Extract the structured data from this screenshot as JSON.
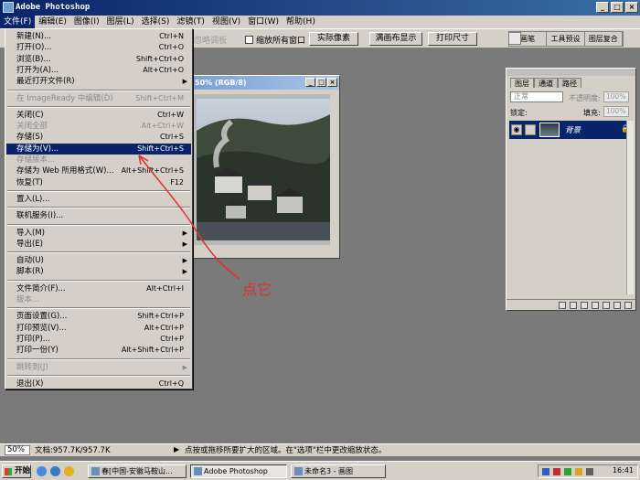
{
  "app": {
    "title": "Adobe Photoshop",
    "window_buttons": [
      "_",
      "□",
      "×"
    ]
  },
  "menubar": [
    {
      "label": "文件(F)",
      "active": true
    },
    {
      "label": "编辑(E)"
    },
    {
      "label": "图像(I)"
    },
    {
      "label": "图层(L)"
    },
    {
      "label": "选择(S)"
    },
    {
      "label": "滤镜(T)"
    },
    {
      "label": "视图(V)"
    },
    {
      "label": "窗口(W)"
    },
    {
      "label": "帮助(H)"
    }
  ],
  "options": {
    "faded_text": "忽略调板",
    "checkbox_label": "缩放所有窗口",
    "buttons": [
      "实际像素",
      "满画布显示",
      "打印尺寸"
    ],
    "palette_well": [
      "画笔",
      "工具预设",
      "图层复合"
    ]
  },
  "file_menu": [
    {
      "label": "新建(N)...",
      "shortcut": "Ctrl+N"
    },
    {
      "label": "打开(O)...",
      "shortcut": "Ctrl+O"
    },
    {
      "label": "浏览(B)...",
      "shortcut": "Shift+Ctrl+O"
    },
    {
      "label": "打开为(A)...",
      "shortcut": "Alt+Ctrl+O"
    },
    {
      "label": "最近打开文件(R)",
      "submenu": true
    },
    {
      "sep": true
    },
    {
      "label": "在 ImageReady 中编辑(D)",
      "shortcut": "Shift+Ctrl+M",
      "disabled": true
    },
    {
      "sep": true
    },
    {
      "label": "关闭(C)",
      "shortcut": "Ctrl+W"
    },
    {
      "label": "关闭全部",
      "shortcut": "Alt+Ctrl+W",
      "disabled": true
    },
    {
      "label": "存储(S)",
      "shortcut": "Ctrl+S"
    },
    {
      "label": "存储为(V)...",
      "shortcut": "Shift+Ctrl+S",
      "highlighted": true
    },
    {
      "label": "存储版本...",
      "disabled": true
    },
    {
      "label": "存储为 Web 所用格式(W)...",
      "shortcut": "Alt+Shift+Ctrl+S"
    },
    {
      "label": "恢复(T)",
      "shortcut": "F12"
    },
    {
      "sep": true
    },
    {
      "label": "置入(L)..."
    },
    {
      "sep": true
    },
    {
      "label": "联机服务(I)..."
    },
    {
      "sep": true
    },
    {
      "label": "导入(M)",
      "submenu": true
    },
    {
      "label": "导出(E)",
      "submenu": true
    },
    {
      "sep": true
    },
    {
      "label": "自动(U)",
      "submenu": true
    },
    {
      "label": "脚本(R)",
      "submenu": true
    },
    {
      "sep": true
    },
    {
      "label": "文件简介(F)...",
      "shortcut": "Alt+Ctrl+I"
    },
    {
      "label": "版本...",
      "disabled": true
    },
    {
      "sep": true
    },
    {
      "label": "页面设置(G)...",
      "shortcut": "Shift+Ctrl+P"
    },
    {
      "label": "打印预览(V)...",
      "shortcut": "Alt+Ctrl+P"
    },
    {
      "label": "打印(P)...",
      "shortcut": "Ctrl+P"
    },
    {
      "label": "打印一份(Y)",
      "shortcut": "Alt+Shift+Ctrl+P"
    },
    {
      "sep": true
    },
    {
      "label": "跳转到(J)",
      "submenu": true,
      "disabled": true
    },
    {
      "sep": true
    },
    {
      "label": "退出(X)",
      "shortcut": "Ctrl+Q"
    }
  ],
  "document": {
    "title": "50% (RGB/8)"
  },
  "layers_panel": {
    "tabs": [
      "图层",
      "通道",
      "路径"
    ],
    "blend_mode": "正常",
    "opacity_label": "不透明度:",
    "opacity_value": "100%",
    "lock_label": "锁定:",
    "fill_label": "填充:",
    "fill_value": "100%",
    "layer_name": "背景",
    "lock_icon": "🔒"
  },
  "annotation": {
    "text": "点它",
    "color": "#e03030"
  },
  "statusbar": {
    "zoom": "50%",
    "doc_info": "文档:957.7K/957.7K",
    "hint": "点按或拖移所要扩大的区域。在\"选项\"栏中更改缩放状态。"
  },
  "taskbar": {
    "start": "开始",
    "tasks": [
      {
        "label": "春[中国-安徽马鞍山..."
      },
      {
        "label": "Adobe Photoshop",
        "active": true
      },
      {
        "label": "未命名3 - 画图"
      }
    ],
    "clock": "16:41"
  },
  "colors": {
    "workspace": "#7a7a7a",
    "chrome": "#d4d0c8",
    "selection": "#0a246a",
    "annotation": "#e03030"
  }
}
